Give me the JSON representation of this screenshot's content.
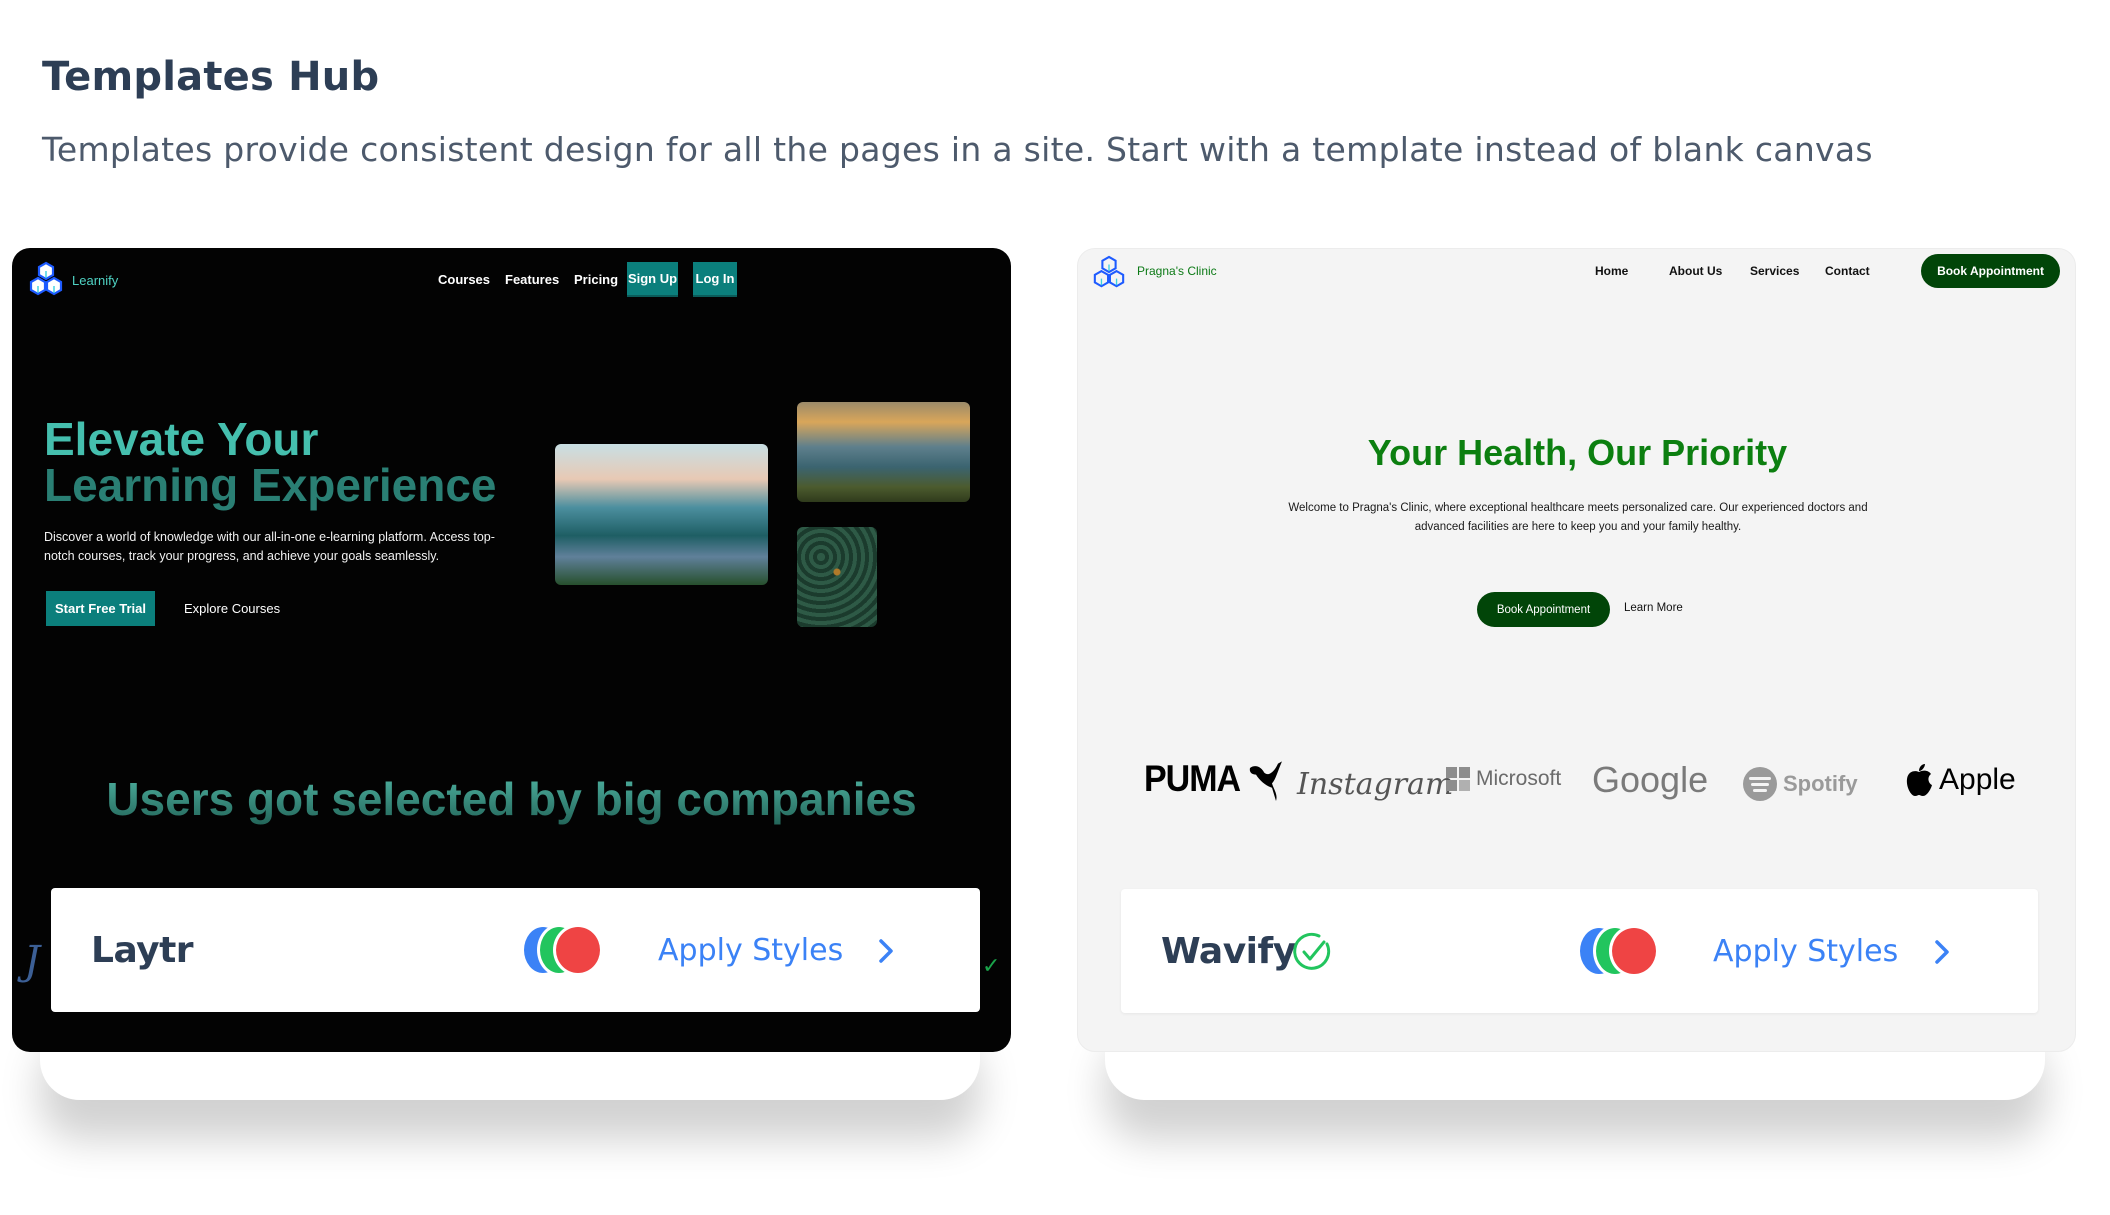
{
  "header": {
    "title": "Templates Hub",
    "subtitle": "Templates provide consistent design for all the pages in a site. Start with a template instead of blank canvas"
  },
  "templates": [
    {
      "name": "Laytr",
      "selected": false,
      "apply_label": "Apply Styles",
      "palette": [
        "#3b82f6",
        "#22c55e",
        "#ef4444"
      ],
      "preview": {
        "brand": "Learnify",
        "nav": [
          "Courses",
          "Features",
          "Pricing"
        ],
        "signup_label": "Sign Up",
        "login_label": "Log In",
        "hero_title_line1": "Elevate Your",
        "hero_title_line2": "Learning Experience",
        "hero_description": "Discover a world of knowledge with our all-in-one e-learning platform. Access top-notch courses, track your progress, and achieve your goals seamlessly.",
        "primary_cta": "Start Free Trial",
        "secondary_cta": "Explore Courses",
        "companies_heading": "Users got selected by big companies",
        "accent_color": "#0b7f7c"
      }
    },
    {
      "name": "Wavify",
      "selected": true,
      "apply_label": "Apply Styles",
      "palette": [
        "#3b82f6",
        "#22c55e",
        "#ef4444"
      ],
      "preview": {
        "brand": "Pragna's Clinic",
        "nav": [
          "Home",
          "About Us",
          "Services",
          "Contact"
        ],
        "nav_cta": "Book Appointment",
        "hero_title": "Your Health, Our Priority",
        "hero_description": "Welcome to Pragna's Clinic, where exceptional healthcare meets personalized care. Our experienced doctors and advanced facilities are here to keep you and your family healthy.",
        "primary_cta": "Book Appointment",
        "secondary_cta": "Learn More",
        "logos": [
          "PUMA",
          "Instagram",
          "Microsoft",
          "Google",
          "Spotify",
          "Apple"
        ],
        "accent_color": "#014508"
      }
    }
  ]
}
